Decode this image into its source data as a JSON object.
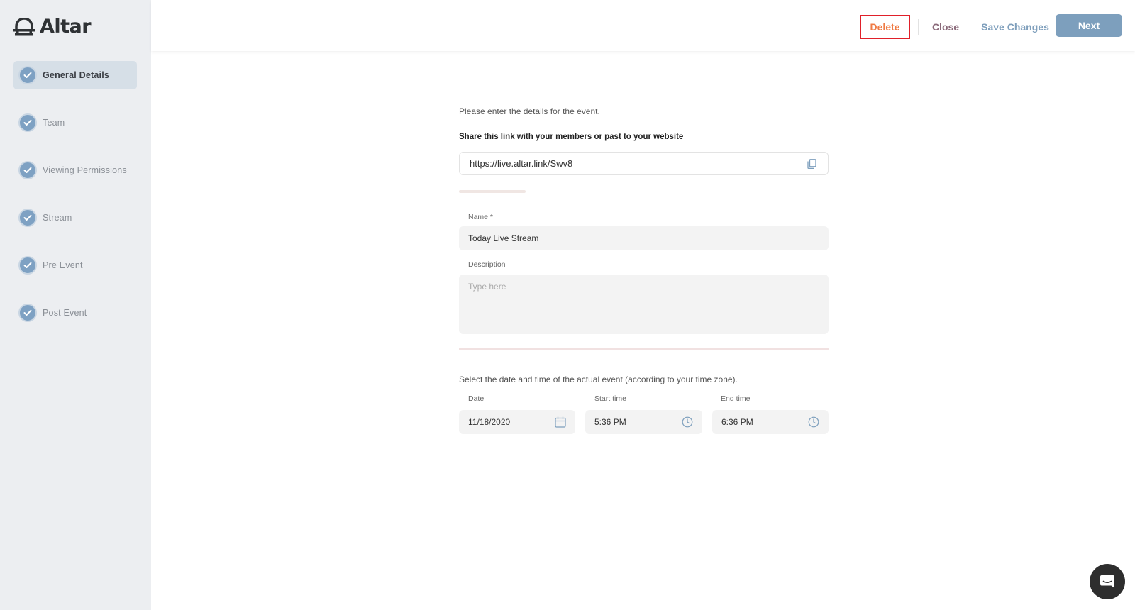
{
  "app": {
    "name": "Altar"
  },
  "sidebar": {
    "steps": [
      {
        "label": "General Details",
        "active": true
      },
      {
        "label": "Team",
        "active": false
      },
      {
        "label": "Viewing Permissions",
        "active": false
      },
      {
        "label": "Stream",
        "active": false
      },
      {
        "label": "Pre Event",
        "active": false
      },
      {
        "label": "Post Event",
        "active": false
      }
    ]
  },
  "header": {
    "delete_label": "Delete",
    "close_label": "Close",
    "save_label": "Save Changes",
    "next_label": "Next"
  },
  "form": {
    "intro": "Please enter the details for the event.",
    "share_label": "Share this link with your members or past to your website",
    "share_link": "https://live.altar.link/Swv8",
    "name_label": "Name *",
    "name_value": "Today Live Stream",
    "description_label": "Description",
    "description_placeholder": "Type here",
    "datetime_intro": "Select the date and time of the actual event (according to your time zone).",
    "date_label": "Date",
    "date_value": "11/18/2020",
    "start_label": "Start time",
    "start_value": "5:36 PM",
    "end_label": "End time",
    "end_value": "6:36 PM"
  },
  "colors": {
    "accent": "#7d9fbd",
    "delete": "#ef7b45",
    "highlight_border": "#e0202a",
    "sidebar_bg": "#eceef1"
  }
}
